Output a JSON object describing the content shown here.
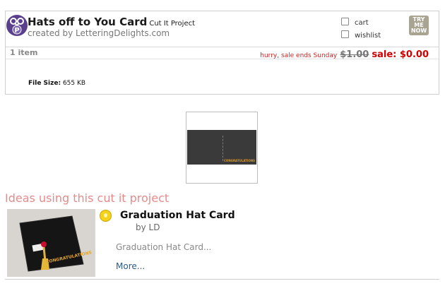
{
  "product": {
    "title": "Hats off to You Card",
    "type": "Cut It Project",
    "creator": "created by LetteringDelights.com",
    "icon": "scissors-p-icon",
    "cart_label": "cart",
    "wishlist_label": "wishlist",
    "try_button": "TRY ME NOW",
    "items": "1 item",
    "hurry": "hurry, sale ends Sunday",
    "old_price": "$1.00",
    "sale_price": "sale: $0.00",
    "file_size_label": "File Size:",
    "file_size_value": "655 KB"
  },
  "preview": {
    "thumb_text": "CONGRATULATIONS"
  },
  "ideas": {
    "heading": "Ideas using this cut it project",
    "items": [
      {
        "title": "Graduation Hat Card",
        "by": "by LD",
        "desc": "Graduation Hat Card...",
        "more": "More...",
        "image_text": "CONGRATULATIONS",
        "icon": "lightbulb-icon"
      }
    ]
  },
  "colors": {
    "sale": "#d20000",
    "hurry": "#cc2222",
    "ideas_heading": "#e88a8a",
    "icon_bg": "#5a3f8c"
  }
}
